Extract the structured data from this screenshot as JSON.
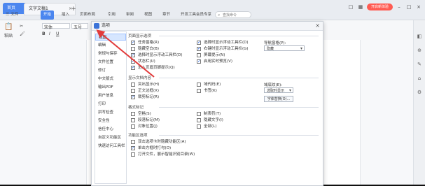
{
  "tabs": {
    "home": "首页",
    "doc": "文字文稿1"
  },
  "ribbon": {
    "file": "三 文件",
    "items": [
      "开始",
      "插入",
      "页面布局",
      "引用",
      "审阅",
      "视图",
      "章节",
      "开发工具",
      "会员专享"
    ],
    "active_index": 0,
    "search_placeholder": "查找命令",
    "right_pill": "开启新体验"
  },
  "toolbar": {
    "paste": "粘贴",
    "font": "宋体",
    "size": "五号"
  },
  "dialog": {
    "title": "选项",
    "nav": [
      "视图",
      "编辑",
      "常规与保存",
      "文件位置",
      "修订",
      "中文版式",
      "输出PDF",
      "用户信息",
      "打印",
      "拼写检查",
      "安全性",
      "信任中心",
      "自定义功能区",
      "快速访问工具栏"
    ],
    "nav_active_index": 0,
    "sections": {
      "page_display": "页面显示选项",
      "show_format": "显示文档内容",
      "format_marks": "格式标记",
      "func_options": "功能区选项"
    },
    "page_display_left": [
      {
        "label": "任务窗格(R)",
        "checked": true
      },
      {
        "label": "隐藏空白(B)",
        "checked": false
      },
      {
        "label": "选择时显示浮动工具栏(D)",
        "checked": true
      },
      {
        "label": "状态栏(U)",
        "checked": true
      },
      {
        "label": "进入页眉页脚提示(Q)",
        "checked": true
      }
    ],
    "page_display_right": [
      {
        "label": "选择时显示浮动工具栏(D)",
        "checked": true
      },
      {
        "label": "右键时显示浮动工具栏(G)",
        "checked": true
      },
      {
        "label": "屏幕提示(N)",
        "checked": false
      },
      {
        "label": "启用实时预览(V)",
        "checked": true
      }
    ],
    "nav_pane_label": "导航窗格(P):",
    "nav_pane_value": "隐藏",
    "show_left": [
      {
        "label": "突出显示(H)",
        "checked": false
      },
      {
        "label": "正文边框(X)",
        "checked": false
      },
      {
        "label": "裁剪标记(R)",
        "checked": true
      }
    ],
    "show_right": [
      {
        "label": "域代码(E)",
        "checked": false
      },
      {
        "label": "书签(K)",
        "checked": false
      }
    ],
    "field_shading_label": "域底纹(E):",
    "field_shading_value": "选取时显示",
    "font_replace_button": "字体替换(O)...",
    "marks_left": [
      {
        "label": "空格(S)",
        "checked": false
      },
      {
        "label": "段落标记(M)",
        "checked": false
      },
      {
        "label": "对象位置(J)",
        "checked": false
      }
    ],
    "marks_right": [
      {
        "label": "制表符(T)",
        "checked": false
      },
      {
        "label": "隐藏文字(I)",
        "checked": false
      },
      {
        "label": "全部(L)",
        "checked": false
      }
    ],
    "func_items": [
      {
        "label": "双击选项卡时隐藏功能区(A)",
        "checked": false
      },
      {
        "label": "单击方框时打勾(O)",
        "checked": true
      },
      {
        "label": "打开文件，展示智能识别目录(W)",
        "checked": false
      }
    ]
  },
  "colors": {
    "accent": "#4b86ef",
    "pill": "#ff5b52",
    "annotation_arrow": "#e23b3b"
  }
}
